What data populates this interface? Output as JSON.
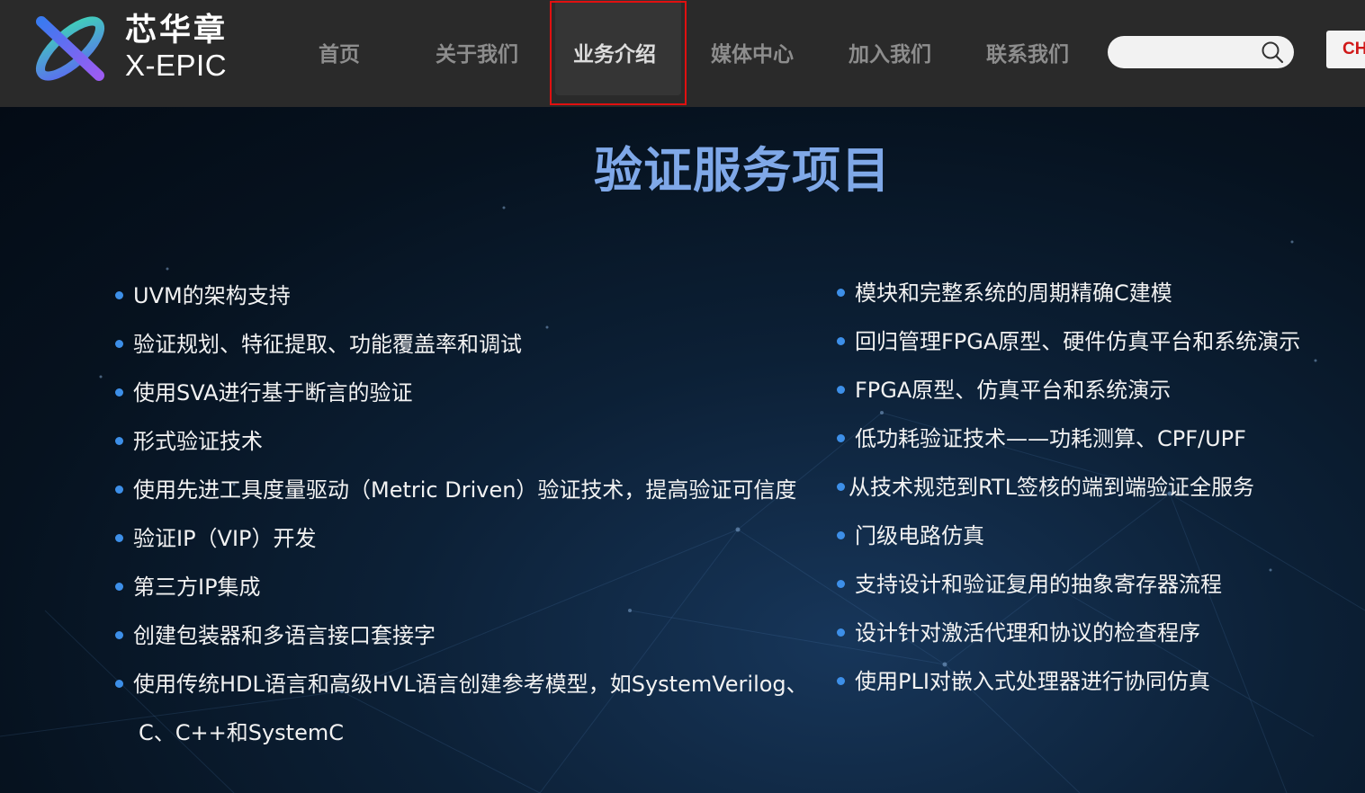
{
  "header": {
    "logo": {
      "cn": "芯华章",
      "en": "X-EPIC"
    },
    "nav": [
      {
        "label": "首页",
        "active": false
      },
      {
        "label": "关于我们",
        "active": false
      },
      {
        "label": "业务介绍",
        "active": true
      },
      {
        "label": "媒体中心",
        "active": false
      },
      {
        "label": "加入我们",
        "active": false
      },
      {
        "label": "联系我们",
        "active": false
      }
    ],
    "search": {
      "placeholder": "",
      "value": ""
    },
    "language": "CH"
  },
  "main": {
    "title": "验证服务项目",
    "left_items": [
      "UVM的架构支持",
      "验证规划、特征提取、功能覆盖率和调试",
      "使用SVA进行基于断言的验证",
      "形式验证技术",
      "使用先进工具度量驱动（Metric Driven）验证技术，提高验证可信度",
      "验证IP（VIP）开发",
      "第三方IP集成",
      "创建包装器和多语言接口套接字",
      "使用传统HDL语言和高级HVL语言创建参考模型，如SystemVerilog、",
      "C、C++和SystemC"
    ],
    "right_items": [
      "模块和完整系统的周期精确C建模",
      "回归管理FPGA原型、硬件仿真平台和系统演示",
      "FPGA原型、仿真平台和系统演示",
      "低功耗验证技术——功耗测算、CPF/UPF",
      "从技术规范到RTL签核的端到端验证全服务",
      "门级电路仿真",
      "支持设计和验证复用的抽象寄存器流程",
      "设计针对激活代理和协议的检查程序",
      "使用PLI对嵌入式处理器进行协同仿真"
    ]
  },
  "colors": {
    "header_bg": "#2a2a2a",
    "title": "#7fa8e8",
    "bullet": "#3d8fe8",
    "active_nav_outline": "#e01010"
  },
  "icons": [
    "x-epic-logo-icon",
    "search-icon"
  ]
}
